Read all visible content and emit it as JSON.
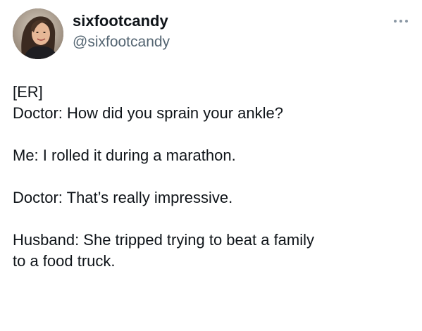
{
  "author": {
    "display_name": "sixfootcandy",
    "handle": "@sixfootcandy",
    "avatar_icon": "profile-photo"
  },
  "more_icon": "more-options-icon",
  "tweet": {
    "lines": [
      "[ER]",
      "Doctor: How did you sprain your ankle?",
      "Me: I rolled it during a marathon.",
      "Doctor: That’s really impressive.",
      "Husband: She tripped trying to beat a family",
      "to a food truck."
    ]
  },
  "colors": {
    "text": "#0f1419",
    "secondary": "#536471",
    "more_dots": "#8b98a5"
  }
}
